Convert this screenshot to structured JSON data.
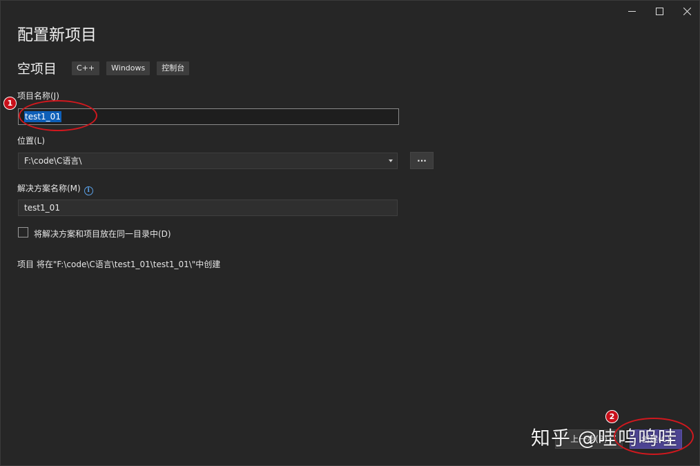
{
  "window": {
    "controls": {
      "minimize_icon": "minimize-icon",
      "maximize_icon": "maximize-icon",
      "close_icon": "close-icon"
    }
  },
  "header": {
    "title": "配置新项目",
    "template_name": "空项目",
    "tags": [
      "C++",
      "Windows",
      "控制台"
    ]
  },
  "form": {
    "project_name": {
      "label": "项目名称(J)",
      "value": "test1_01"
    },
    "location": {
      "label": "位置(L)",
      "value": "F:\\code\\C语言\\",
      "browse_label": "..."
    },
    "solution_name": {
      "label": "解决方案名称(M)",
      "info_icon": "i",
      "value": "test1_01"
    },
    "same_directory": {
      "label": "将解决方案和项目放在同一目录中(D)",
      "checked": false
    },
    "creation_note": "项目 将在\"F:\\code\\C语言\\test1_01\\test1_01\\\"中创建"
  },
  "footer": {
    "back_label": "上一步(B)",
    "create_label": "创建(C)"
  },
  "annotations": {
    "marker_1": "1",
    "marker_2": "2",
    "color": "#d0181e"
  },
  "watermark": "知乎 @哇呜呜哇",
  "colors": {
    "background": "#262626",
    "accent": "#4c4392",
    "selection": "#0e5fb8",
    "info": "#5aa0e6"
  }
}
